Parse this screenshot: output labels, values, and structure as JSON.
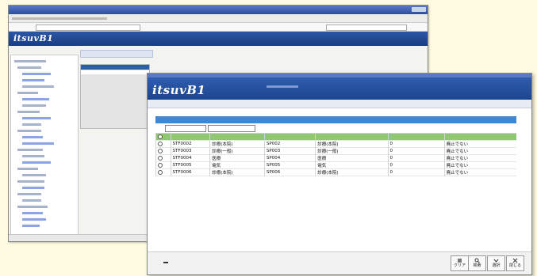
{
  "front": {
    "logo": "itsuvB1",
    "rows": [
      {
        "code": "",
        "name": "",
        "code2": "",
        "name2": "",
        "flag": "",
        "status": "",
        "highlight": true
      },
      {
        "code": "STF0002",
        "name": "診療(本院)",
        "code2": "SP002",
        "name2": "診療(本院)",
        "flag": "0",
        "status": "廃止でない",
        "highlight": false
      },
      {
        "code": "STF0003",
        "name": "診療(一般)",
        "code2": "SP003",
        "name2": "診療(一般)",
        "flag": "0",
        "status": "廃止でない",
        "highlight": false
      },
      {
        "code": "STF0004",
        "name": "医療",
        "code2": "SP004",
        "name2": "医療",
        "flag": "0",
        "status": "廃止でない",
        "highlight": false
      },
      {
        "code": "STF0005",
        "name": "電気",
        "code2": "SP005",
        "name2": "電気",
        "flag": "0",
        "status": "廃止でない",
        "highlight": false
      },
      {
        "code": "STF0006",
        "name": "診療(本院)",
        "code2": "SP006",
        "name2": "診療(本院)",
        "flag": "0",
        "status": "廃止でない",
        "highlight": false
      }
    ],
    "footer_buttons": [
      {
        "label": "クリア"
      },
      {
        "label": "検索"
      },
      {
        "label": "選択"
      },
      {
        "label": "閉じる"
      }
    ]
  },
  "back": {
    "logo": "itsuvB1"
  },
  "colors": {
    "banner": "#2c57a6",
    "header_row": "#3f87d4",
    "highlight_row": "#8fc870"
  }
}
